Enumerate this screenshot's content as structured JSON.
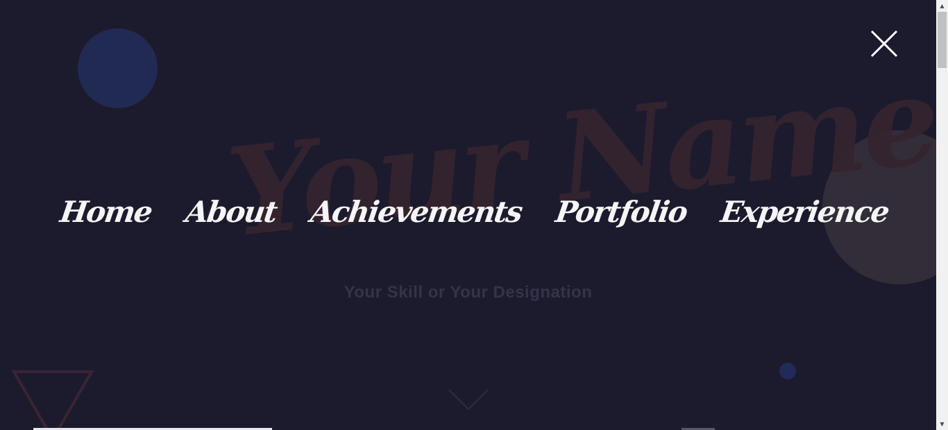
{
  "hero": {
    "name": "Your Name",
    "skill": "Your Skill or Your Designation"
  },
  "menu": {
    "items": [
      {
        "label": "Home"
      },
      {
        "label": "About"
      },
      {
        "label": "Achievements"
      },
      {
        "label": "Portfolio"
      },
      {
        "label": "Experience"
      }
    ],
    "close_icon": "close-icon"
  },
  "colors": {
    "background": "#1c1b2e",
    "menu_text": "#f5f5f5",
    "hero_name": "#35242f",
    "hero_skill": "#34334a",
    "circle_blue": "#212a52",
    "circle_brown": "#322d38",
    "triangle_outline": "#3a2433"
  },
  "icons": {
    "scroll_down": "chevron-down-icon",
    "scroll_up_arrow": "▲",
    "scroll_down_arrow": "▼"
  }
}
